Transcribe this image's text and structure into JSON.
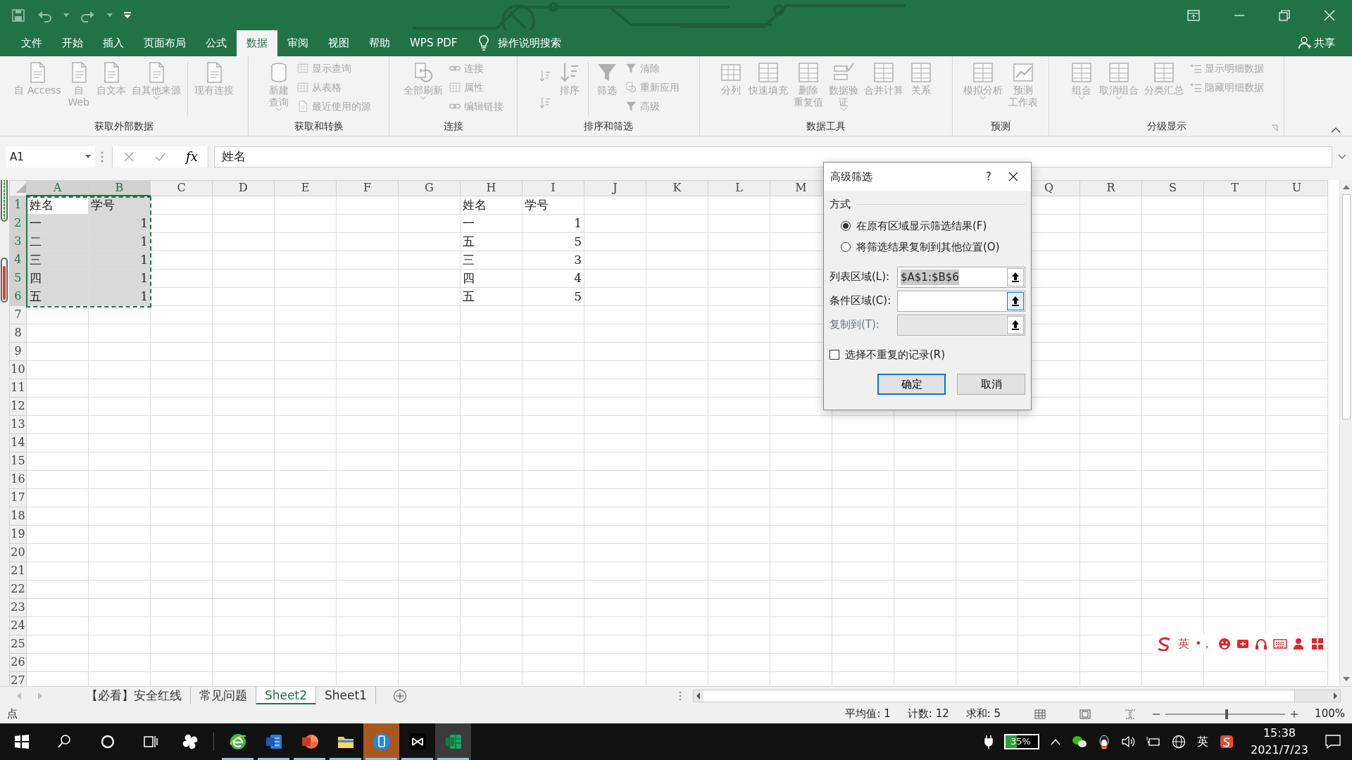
{
  "tabs": [
    {
      "label": "文件",
      "selected": false
    },
    {
      "label": "开始",
      "selected": false
    },
    {
      "label": "插入",
      "selected": false
    },
    {
      "label": "页面布局",
      "selected": false
    },
    {
      "label": "公式",
      "selected": false
    },
    {
      "label": "数据",
      "selected": true
    },
    {
      "label": "审阅",
      "selected": false
    },
    {
      "label": "视图",
      "selected": false
    },
    {
      "label": "帮助",
      "selected": false
    },
    {
      "label": "WPS PDF",
      "selected": false
    }
  ],
  "tell_me": "操作说明搜索",
  "share": "共享",
  "ribbon": {
    "disabled": true,
    "groups": [
      {
        "label": "获取外部数据",
        "items": [
          {
            "kind": "large",
            "label": "自 Access"
          },
          {
            "kind": "large",
            "lines": [
              "自",
              "Web"
            ]
          },
          {
            "kind": "large",
            "label": "自文本"
          },
          {
            "kind": "large_menu",
            "label": "自其他来源"
          },
          {
            "kind": "separator"
          },
          {
            "kind": "large",
            "label": "现有连接"
          }
        ]
      },
      {
        "label": "获取和转换",
        "items": [
          {
            "kind": "large_menu",
            "lines": [
              "新建",
              "查询"
            ]
          },
          {
            "kind": "stack",
            "items": [
              "显示查询",
              "从表格",
              "最近使用的源"
            ]
          }
        ]
      },
      {
        "label": "连接",
        "items": [
          {
            "kind": "large_menu",
            "label": "全部刷新"
          },
          {
            "kind": "stack",
            "items": [
              "连接",
              "属性",
              "编辑链接"
            ]
          }
        ]
      },
      {
        "label": "排序和筛选",
        "items": [
          {
            "kind": "sort_pair"
          },
          {
            "kind": "large",
            "label": "排序"
          },
          {
            "kind": "separator"
          },
          {
            "kind": "large",
            "label": "筛选"
          },
          {
            "kind": "stack",
            "items": [
              "清除",
              "重新应用",
              "高级"
            ]
          }
        ]
      },
      {
        "label": "数据工具",
        "items": [
          {
            "kind": "large",
            "label": "分列"
          },
          {
            "kind": "large",
            "label": "快速填充"
          },
          {
            "kind": "large",
            "lines": [
              "删除",
              "重复值"
            ]
          },
          {
            "kind": "large_menu",
            "lines": [
              "数据验",
              "证"
            ]
          },
          {
            "kind": "large",
            "label": "合并计算"
          },
          {
            "kind": "large",
            "label": "关系"
          }
        ]
      },
      {
        "label": "预测",
        "items": [
          {
            "kind": "large_menu",
            "label": "模拟分析"
          },
          {
            "kind": "large",
            "lines": [
              "预测",
              "工作表"
            ]
          }
        ]
      },
      {
        "label": "分级显示",
        "items": [
          {
            "kind": "large_menu",
            "label": "组合"
          },
          {
            "kind": "large_menu",
            "label": "取消组合"
          },
          {
            "kind": "large",
            "label": "分类汇总"
          },
          {
            "kind": "stack",
            "items": [
              "显示明细数据",
              "隐藏明细数据"
            ]
          }
        ]
      }
    ]
  },
  "formula_bar": {
    "name_box": "A1",
    "fx": "fx",
    "formula": "姓名"
  },
  "sheet": {
    "columns_left": [
      "A",
      "B",
      "C",
      "D",
      "E",
      "F",
      "G",
      "H",
      "I",
      "J",
      "K",
      "L",
      "M"
    ],
    "columns_right": [
      "Q",
      "R",
      "S",
      "T",
      "U"
    ],
    "rows": [
      "1",
      "2",
      "3",
      "4",
      "5",
      "6",
      "7",
      "8",
      "9",
      "10",
      "11",
      "12",
      "13",
      "14",
      "15",
      "16",
      "17",
      "18",
      "19",
      "20",
      "21",
      "22",
      "23",
      "24",
      "25",
      "26",
      "27"
    ],
    "range_left": {
      "selected": true,
      "rows": [
        [
          "姓名",
          "学号"
        ],
        [
          "一",
          "1"
        ],
        [
          "二",
          "1"
        ],
        [
          "三",
          "1"
        ],
        [
          "四",
          "1"
        ],
        [
          "五",
          "1"
        ]
      ]
    },
    "range_right": {
      "rows": [
        [
          "姓名",
          "学号"
        ],
        [
          "一",
          "1"
        ],
        [
          "五",
          "5"
        ],
        [
          "三",
          "3"
        ],
        [
          "四",
          "4"
        ],
        [
          "五",
          "5"
        ]
      ]
    }
  },
  "dialog": {
    "title": "高级筛选",
    "help": "?",
    "section": "方式",
    "options": [
      {
        "label": "在原有区域显示筛选结果(F)",
        "selected": true
      },
      {
        "label": "将筛选结果复制到其他位置(O)",
        "selected": false
      }
    ],
    "fields": [
      {
        "label": "列表区域(L):",
        "value": "$A$1:$B$6",
        "value_selected": true,
        "focused": false,
        "disabled": false
      },
      {
        "label": "条件区域(C):",
        "focused": true,
        "disabled": false
      },
      {
        "label": "复制到(T):",
        "focused": false,
        "disabled": true
      }
    ],
    "unique": {
      "label": "选择不重复的记录(R)",
      "checked": false
    },
    "buttons": [
      {
        "label": "确定",
        "default": true
      },
      {
        "label": "取消",
        "default": false
      }
    ]
  },
  "sheet_tabs": [
    {
      "label": "【必看】安全红线",
      "selected": false
    },
    {
      "label": "常见问题",
      "selected": false
    },
    {
      "label": "Sheet2",
      "selected": true
    },
    {
      "label": "Sheet1",
      "selected": false
    }
  ],
  "status_bar": {
    "mode": "点",
    "stats": [
      "平均值: 1",
      "计数: 12",
      "求和: 5"
    ],
    "zoom": {
      "level": 0.5,
      "reading": "100%"
    }
  },
  "ime_toolbar": {
    "mode": "英",
    "punctuation": "•，"
  },
  "taskbar": {
    "apps": [
      {
        "running": false,
        "active": false,
        "flashing": false
      },
      {
        "running": true,
        "active": false,
        "flashing": false
      },
      {
        "running": true,
        "active": false,
        "flashing": false
      },
      {
        "running": true,
        "active": false,
        "flashing": false
      },
      {
        "running": true,
        "active": false,
        "flashing": false
      },
      {
        "running": true,
        "active": false,
        "flashing": true
      },
      {
        "running": true,
        "active": false,
        "flashing": false
      },
      {
        "running": true,
        "active": true,
        "flashing": false
      }
    ],
    "tray": {
      "battery": "35%",
      "input": "英",
      "time": "15:38",
      "date": "2021/7/23"
    }
  }
}
